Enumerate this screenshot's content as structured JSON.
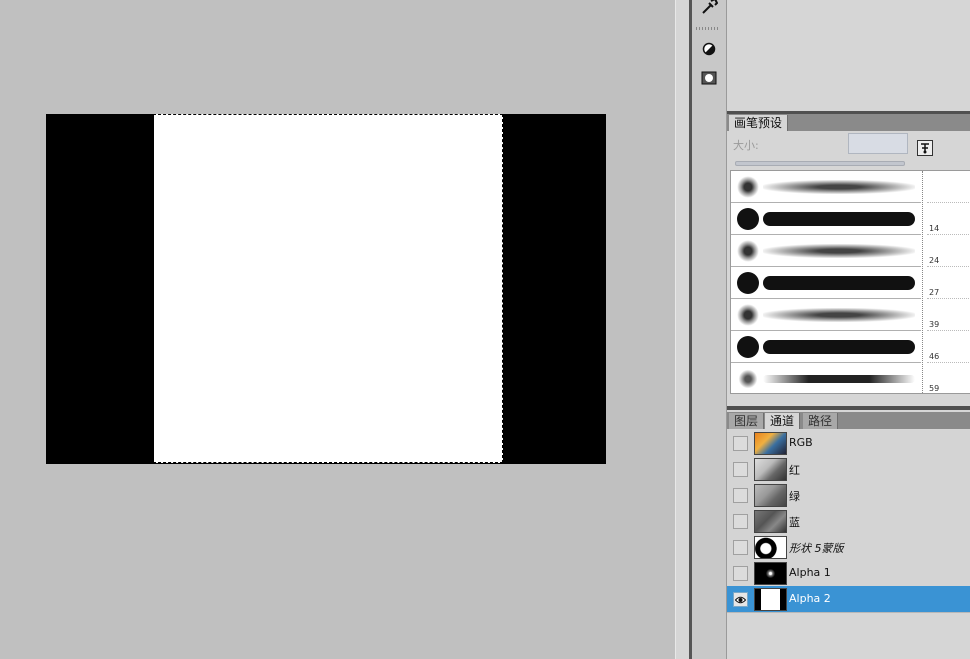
{
  "brush_panel": {
    "tab_label": "画笔预设",
    "size_label": "大小:",
    "brush_sizes": [
      "",
      "14",
      "24",
      "27",
      "39",
      "46",
      "59"
    ]
  },
  "channels_panel": {
    "tabs": [
      {
        "label": "图层",
        "active": false
      },
      {
        "label": "通道",
        "active": true
      },
      {
        "label": "路径",
        "active": false
      }
    ],
    "channels": [
      {
        "name": "RGB",
        "visible": false,
        "selected": false
      },
      {
        "name": "红",
        "visible": false,
        "selected": false
      },
      {
        "name": "绿",
        "visible": false,
        "selected": false
      },
      {
        "name": "蓝",
        "visible": false,
        "selected": false
      },
      {
        "name": "形状 5蒙版",
        "visible": false,
        "selected": false
      },
      {
        "name": "Alpha 1",
        "visible": false,
        "selected": false
      },
      {
        "name": "Alpha 2",
        "visible": true,
        "selected": true
      }
    ]
  },
  "colors": {
    "canvas_bg": "#c0c0c0",
    "selection_highlight": "#3a93d4",
    "panel_bg": "#d6d6d6"
  }
}
